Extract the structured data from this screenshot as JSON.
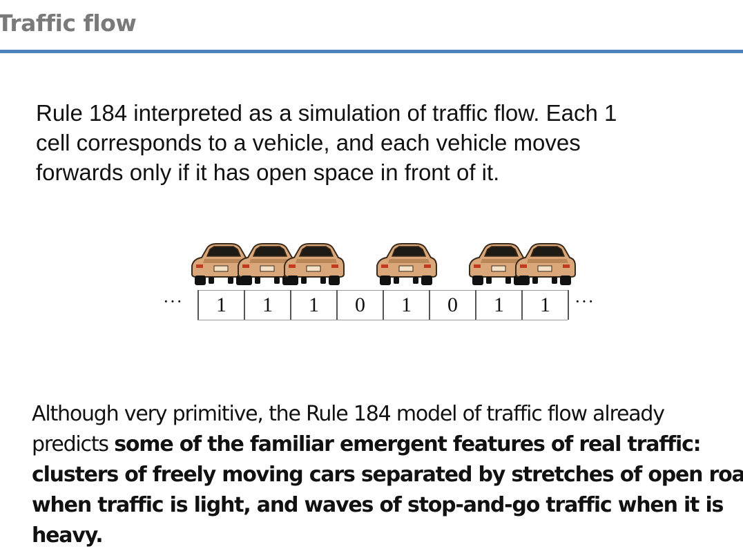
{
  "slide": {
    "title": "Traffic flow",
    "accent_color": "#4f81bd",
    "intro_lines": [
      "Rule 184 interpreted as a simulation of traffic flow. Each 1",
      "cell corresponds to a vehicle, and each vehicle moves",
      "forwards only if it has open space in front of it."
    ],
    "figure": {
      "ellipsis_left": "···",
      "ellipsis_right": "···",
      "cells": [
        "1",
        "1",
        "1",
        "0",
        "1",
        "0",
        "1",
        "1"
      ],
      "car_icon": "car-icon",
      "car_color": "#d9a77a"
    },
    "conclusion": {
      "line1": "Although very primitive, the Rule 184 model of traffic flow already",
      "line2_normal": "predicts ",
      "line2_bold": "some of the familiar emergent features of real traffic:",
      "line3_bold": "clusters of freely moving cars separated by stretches of open road",
      "line4_bold": "when traffic is light, and waves of stop-and-go traffic when it is",
      "line5_bold": "heavy."
    }
  }
}
